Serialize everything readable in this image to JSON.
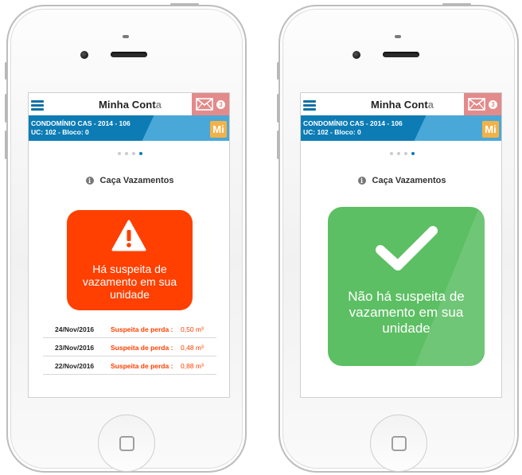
{
  "screens": [
    {
      "header": {
        "menu_icon": "hamburger-menu-icon",
        "title_main": "Minha Cont",
        "title_last": "a",
        "mail_icon": "envelope-icon",
        "mail_count": "3"
      },
      "account": {
        "line1": "CONDOMÍNIO CAS - 2014 - 106",
        "line2": "UC: 102 - Bloco: 0",
        "badge": "Mi"
      },
      "pager": {
        "total": 4,
        "active": 4
      },
      "section": {
        "info_icon": "info-icon",
        "title": "Caça Vazamentos"
      },
      "status": {
        "icon": "warning-triangle-icon",
        "color": "#ff4000",
        "text": "Há suspeita de vazamento em sua unidade"
      },
      "rows": [
        {
          "date": "24/Nov/2016",
          "label": "Suspeita de perda :",
          "value": "0,50 m³"
        },
        {
          "date": "23/Nov/2016",
          "label": "Suspeita de perda :",
          "value": "0,48 m³"
        },
        {
          "date": "22/Nov/2016",
          "label": "Suspeita de perda :",
          "value": "0,88 m³"
        }
      ]
    },
    {
      "header": {
        "menu_icon": "hamburger-menu-icon",
        "title_main": "Minha Cont",
        "title_last": "a",
        "mail_icon": "envelope-icon",
        "mail_count": "3"
      },
      "account": {
        "line1": "CONDOMÍNIO CAS - 2014 - 106",
        "line2": "UC: 102 - Bloco: 0",
        "badge": "Mi"
      },
      "pager": {
        "total": 4,
        "active": 4
      },
      "section": {
        "info_icon": "info-icon",
        "title": "Caça Vazamentos"
      },
      "status": {
        "icon": "checkmark-icon",
        "color": "#5cbf63",
        "text": "Não há suspeita de vazamento em sua unidade"
      }
    }
  ],
  "colors": {
    "brand_blue": "#0d7cb5",
    "mail_red": "#e38a8a",
    "badge_orange": "#f2b24a"
  }
}
